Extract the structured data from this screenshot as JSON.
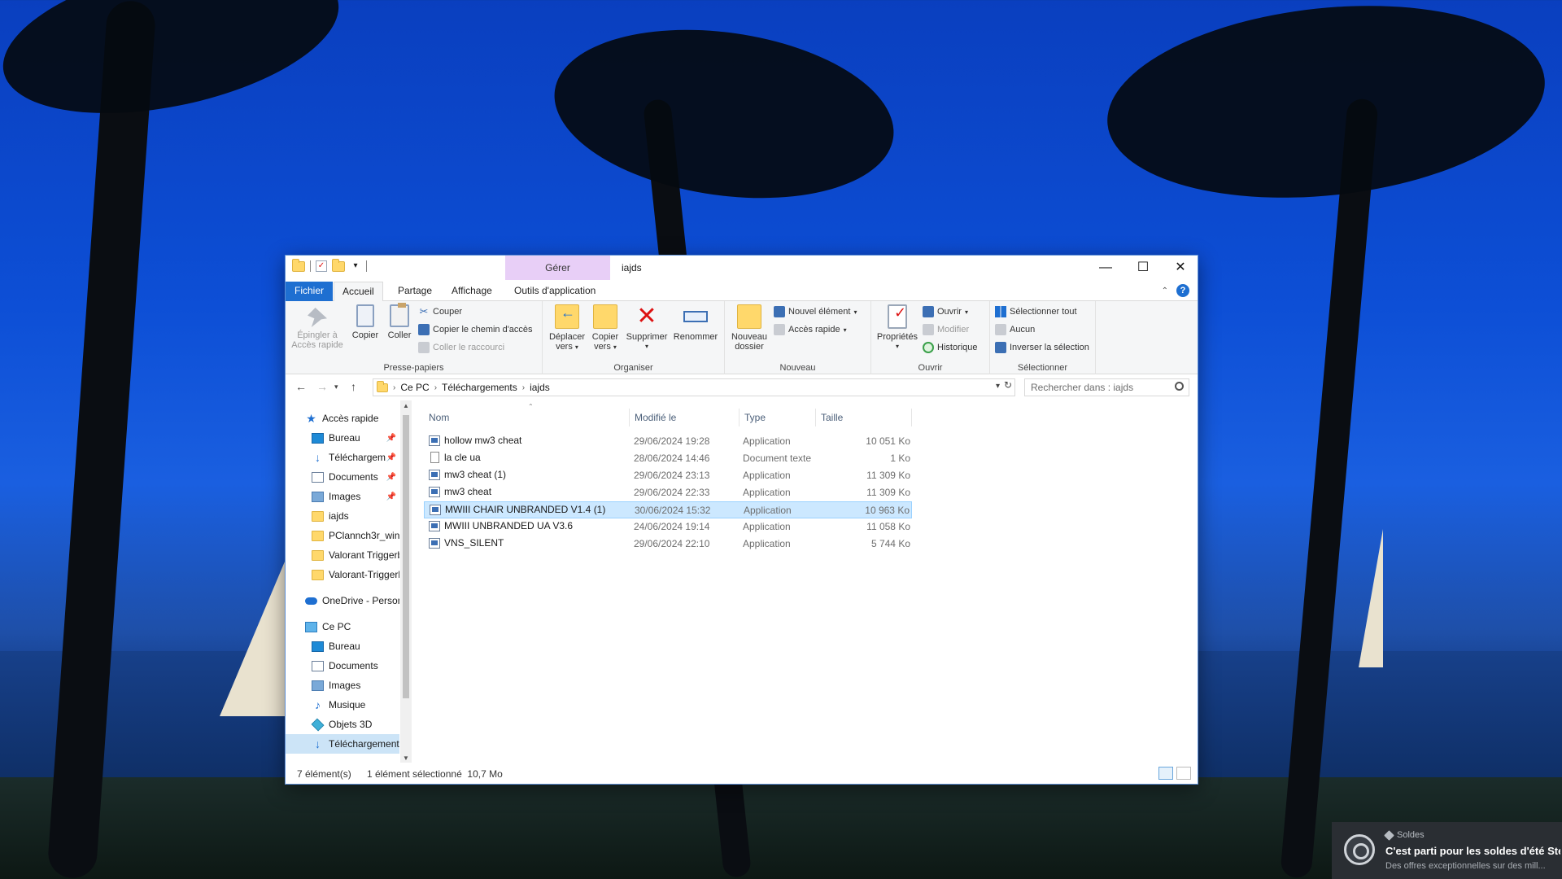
{
  "window": {
    "title": "iajds",
    "contextual_tab_group": "Gérer",
    "controls": {
      "minimize": "—",
      "maximize": "☐",
      "close": "✕"
    }
  },
  "ribbon_tabs": [
    "Fichier",
    "Accueil",
    "Partage",
    "Affichage",
    "Outils d'application"
  ],
  "ribbon": {
    "clipboard": {
      "label": "Presse-papiers",
      "pin": "Épingler à Accès rapide",
      "pin_line1": "Épingler à",
      "pin_line2": "Accès rapide",
      "copy": "Copier",
      "paste": "Coller",
      "cut": "Couper",
      "copy_path": "Copier le chemin d'accès",
      "paste_shortcut": "Coller le raccourci"
    },
    "organize": {
      "label": "Organiser",
      "move_line1": "Déplacer",
      "move_line2": "vers",
      "copy_line1": "Copier",
      "copy_line2": "vers",
      "delete": "Supprimer",
      "rename": "Renommer"
    },
    "new": {
      "label": "Nouveau",
      "new_folder_line1": "Nouveau",
      "new_folder_line2": "dossier",
      "new_item": "Nouvel élément",
      "quick_access": "Accès rapide"
    },
    "open": {
      "label": "Ouvrir",
      "properties": "Propriétés",
      "open": "Ouvrir",
      "edit": "Modifier",
      "history": "Historique"
    },
    "select": {
      "label": "Sélectionner",
      "select_all": "Sélectionner tout",
      "select_none": "Aucun",
      "invert": "Inverser la sélection"
    }
  },
  "address": {
    "crumbs": [
      "Ce PC",
      "Téléchargements",
      "iajds"
    ],
    "search_placeholder": "Rechercher dans : iajds"
  },
  "nav": {
    "quick_access": "Accès rapide",
    "quick_items": [
      "Bureau",
      "Téléchargements",
      "Documents",
      "Images",
      "iajds",
      "PClannch3r_win",
      "Valorant Triggerbot",
      "Valorant-Triggerbot"
    ],
    "onedrive": "OneDrive - Personnel",
    "this_pc": "Ce PC",
    "pc_items": [
      "Bureau",
      "Documents",
      "Images",
      "Musique",
      "Objets 3D",
      "Téléchargements"
    ]
  },
  "columns": {
    "name": "Nom",
    "modified": "Modifié le",
    "type": "Type",
    "size": "Taille"
  },
  "files": [
    {
      "name": "hollow mw3 cheat",
      "modified": "29/06/2024 19:28",
      "type": "Application",
      "size": "10 051 Ko",
      "icon": "app-icon"
    },
    {
      "name": "la cle ua",
      "modified": "28/06/2024 14:46",
      "type": "Document texte",
      "size": "1 Ko",
      "icon": "text-file-icon"
    },
    {
      "name": "mw3 cheat (1)",
      "modified": "29/06/2024 23:13",
      "type": "Application",
      "size": "11 309 Ko",
      "icon": "app-icon"
    },
    {
      "name": "mw3 cheat",
      "modified": "29/06/2024 22:33",
      "type": "Application",
      "size": "11 309 Ko",
      "icon": "app-icon"
    },
    {
      "name": "MWIII CHAIR UNBRANDED V1.4 (1)",
      "modified": "30/06/2024 15:32",
      "type": "Application",
      "size": "10 963 Ko",
      "icon": "app-icon",
      "selected": true
    },
    {
      "name": "MWIII UNBRANDED UA V3.6",
      "modified": "24/06/2024 19:14",
      "type": "Application",
      "size": "11 058 Ko",
      "icon": "app-icon"
    },
    {
      "name": "VNS_SILENT",
      "modified": "29/06/2024 22:10",
      "type": "Application",
      "size": "5 744 Ko",
      "icon": "app-icon"
    }
  ],
  "status": {
    "count": "7 élément(s)",
    "selection": "1 élément sélectionné  10,7 Mo"
  },
  "toast": {
    "category": "Soldes",
    "title": "C'est parti pour les soldes d'été Ste...",
    "body": "Des offres exceptionnelles sur des mill..."
  },
  "colors": {
    "accent": "#1e6fd1",
    "selection": "#cce8ff",
    "context_tab": "#e8cff7",
    "toast_bg": "#2a2e33"
  }
}
